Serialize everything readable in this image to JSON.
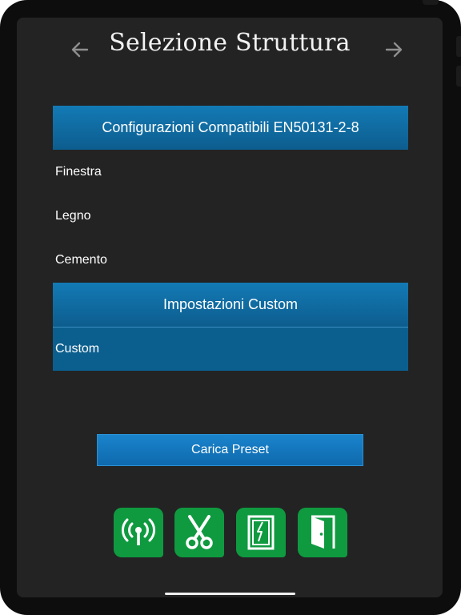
{
  "header": {
    "title": "Selezione Struttura",
    "back_icon": "arrow-left-icon",
    "forward_icon": "arrow-right-icon"
  },
  "compatible_section": {
    "title": "Configurazioni Compatibili EN50131-2-8",
    "items": [
      "Finestra",
      "Legno",
      "Cemento"
    ]
  },
  "custom_section": {
    "title": "Impostazioni Custom",
    "items": [
      "Custom"
    ]
  },
  "load_preset_button": "Carica Preset",
  "bottom_toolbar": {
    "icons": [
      "wireless-signal-icon",
      "scissors-icon",
      "window-icon",
      "door-icon"
    ],
    "color": "#0f9a40"
  },
  "colors": {
    "header_blue": "#137ab5",
    "button_blue": "#1a84cc",
    "background": "#232323"
  }
}
